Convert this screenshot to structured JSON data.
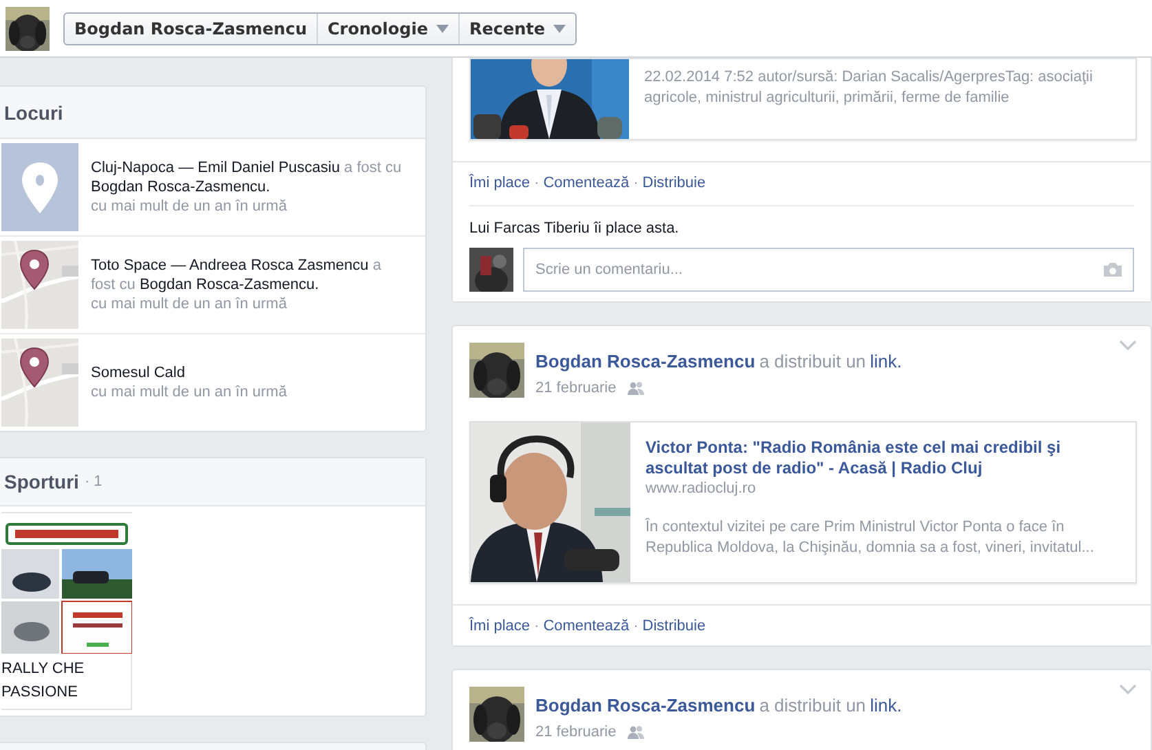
{
  "top_bar": {
    "profile_name": "Bogdan Rosca-Zasmencu",
    "menus": [
      "Cronologie",
      "Recente"
    ]
  },
  "places": {
    "title": "Locuri",
    "items": [
      {
        "kind": "placeholder",
        "title": "Cluj-Napoca — Emil Daniel Puscasiu",
        "verb": "a fost cu",
        "with": "Bogdan Rosca-Zasmencu.",
        "time": "cu mai mult de un an în urmă"
      },
      {
        "kind": "map",
        "title": "Toto Space — Andreea Rosca Zasmencu",
        "verb": "a fost cu",
        "with": "Bogdan Rosca-Zasmencu.",
        "time": "cu mai mult de un an în urmă"
      },
      {
        "kind": "map",
        "title": "Somesul Cald",
        "time": "cu mai mult de un an în urmă"
      }
    ]
  },
  "sports": {
    "title": "Sporturi",
    "separator": "·",
    "count": "1",
    "items": [
      {
        "kind": "picture",
        "caption": "RALLY CHE PASSIONE"
      }
    ]
  },
  "posts": [
    {
      "link": {
        "description": "22.02.2014 7:52 autor/sursă: Darian Sacalis/AgerpresTag: asociaţii agricole, ministrul agriculturii, primării, ferme de familie"
      },
      "actions": [
        "Îmi place",
        "Comentează",
        "Distribuie"
      ],
      "separator": "·",
      "likes": "Lui Farcas Tiberiu îi place asta.",
      "comment_placeholder": "Scrie un comentariu..."
    },
    {
      "author": "Bogdan Rosca-Zasmencu",
      "action": "a distribuit un",
      "object": "link.",
      "date": "21 februarie",
      "link": {
        "title": "Victor Ponta: \"Radio România este cel mai credibil şi ascultat post de radio\" - Acasă | Radio Cluj",
        "url": "www.radiocluj.ro",
        "description": "În contextul vizitei pe care Prim Ministrul Victor Ponta o face în Republica Moldova, la Chişinău, domnia sa a fost, vineri, invitatul..."
      },
      "actions": [
        "Îmi place",
        "Comentează",
        "Distribuie"
      ],
      "separator": "·"
    },
    {
      "author": "Bogdan Rosca-Zasmencu",
      "action": "a distribuit un",
      "object": "link.",
      "date": "21 februarie"
    }
  ]
}
